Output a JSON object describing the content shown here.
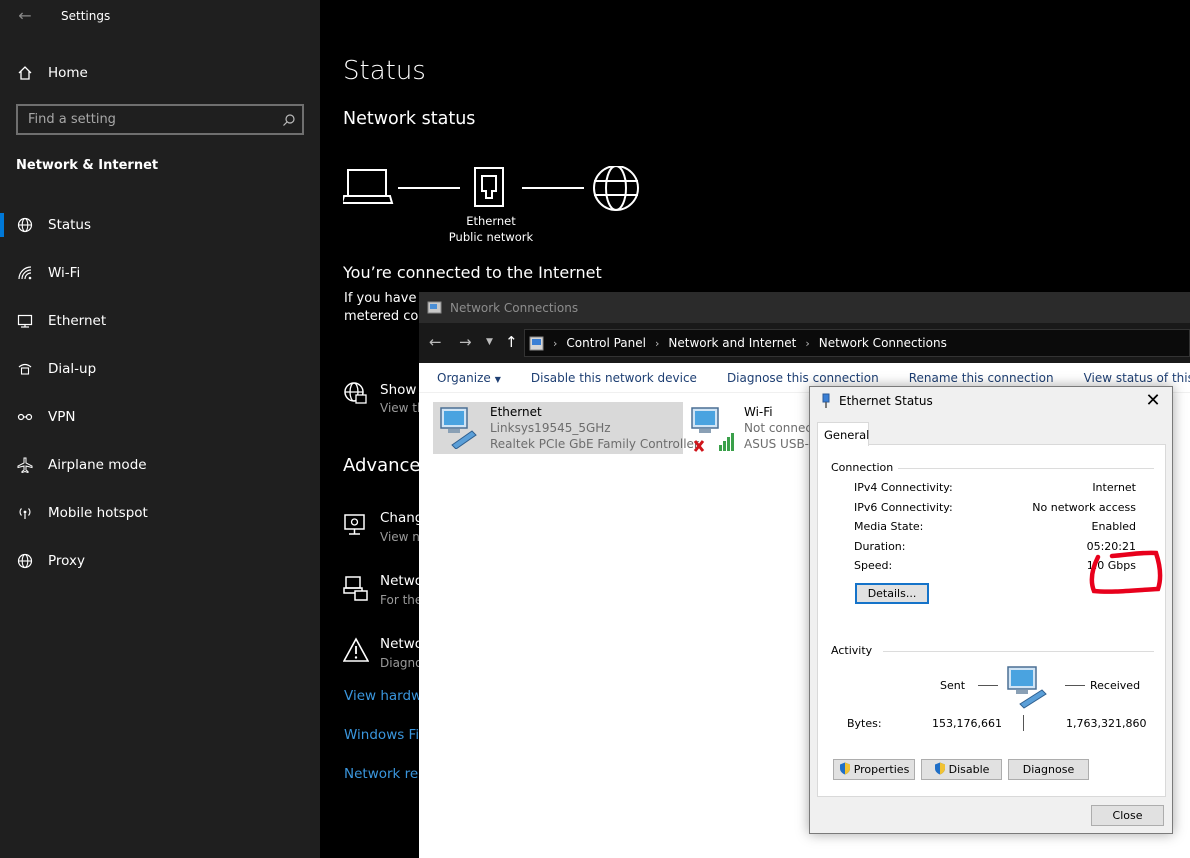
{
  "settings": {
    "title": "Settings",
    "home_label": "Home",
    "search_placeholder": "Find a setting",
    "section_title": "Network & Internet",
    "nav": [
      {
        "label": "Status",
        "icon": "globe-icon"
      },
      {
        "label": "Wi-Fi",
        "icon": "wifi-icon"
      },
      {
        "label": "Ethernet",
        "icon": "ethernet-icon"
      },
      {
        "label": "Dial-up",
        "icon": "dialup-icon"
      },
      {
        "label": "VPN",
        "icon": "vpn-icon"
      },
      {
        "label": "Airplane mode",
        "icon": "airplane-icon"
      },
      {
        "label": "Mobile hotspot",
        "icon": "hotspot-icon"
      },
      {
        "label": "Proxy",
        "icon": "globe-icon"
      }
    ],
    "accent_color": "#0078d7"
  },
  "status_page": {
    "title": "Status",
    "network_status_title": "Network status",
    "adapter_name": "Ethernet",
    "network_profile": "Public network",
    "connected_text": "You’re connected to the Internet",
    "metered_line1": "If you have a",
    "metered_line2": "metered co",
    "show_title": "Show",
    "show_sub": "View th",
    "advanced_title": "Advance",
    "change_title": "Chang",
    "change_sub": "View n",
    "sharing_title": "Netwo",
    "sharing_sub": "For the",
    "troubleshoot_title": "Netwo",
    "troubleshoot_sub": "Diagno",
    "links": [
      "View hardwa",
      "Windows Fir",
      "Network res"
    ],
    "link_color": "#3a96dd"
  },
  "network_connections": {
    "title": "Network Connections",
    "breadcrumb": [
      "Control Panel",
      "Network and Internet",
      "Network Connections"
    ],
    "toolbar": {
      "organize": "Organize",
      "disable": "Disable this network device",
      "diagnose": "Diagnose this connection",
      "rename": "Rename this connection",
      "view_status": "View status of this connection"
    },
    "items": [
      {
        "name": "Ethernet",
        "network": "Linksys19545_5GHz",
        "device": "Realtek PCIe GbE Family Controller"
      },
      {
        "name": "Wi-Fi",
        "network": "Not connect",
        "device": "ASUS USB-A"
      }
    ]
  },
  "ethernet_status": {
    "title": "Ethernet Status",
    "tab": "General",
    "connection_label": "Connection",
    "rows": [
      {
        "key": "IPv4 Connectivity:",
        "value": "Internet"
      },
      {
        "key": "IPv6 Connectivity:",
        "value": "No network access"
      },
      {
        "key": "Media State:",
        "value": "Enabled"
      },
      {
        "key": "Duration:",
        "value": "05:20:21"
      },
      {
        "key": "Speed:",
        "value": "1.0 Gbps"
      }
    ],
    "details_button": "Details...",
    "activity_label": "Activity",
    "sent_label": "Sent",
    "received_label": "Received",
    "bytes_label": "Bytes:",
    "bytes_sent": "153,176,661",
    "bytes_received": "1,763,321,860",
    "properties_button": "Properties",
    "disable_button": "Disable",
    "diagnose_button": "Diagnose",
    "close_button": "Close",
    "highlight_color": "#e8001c"
  }
}
